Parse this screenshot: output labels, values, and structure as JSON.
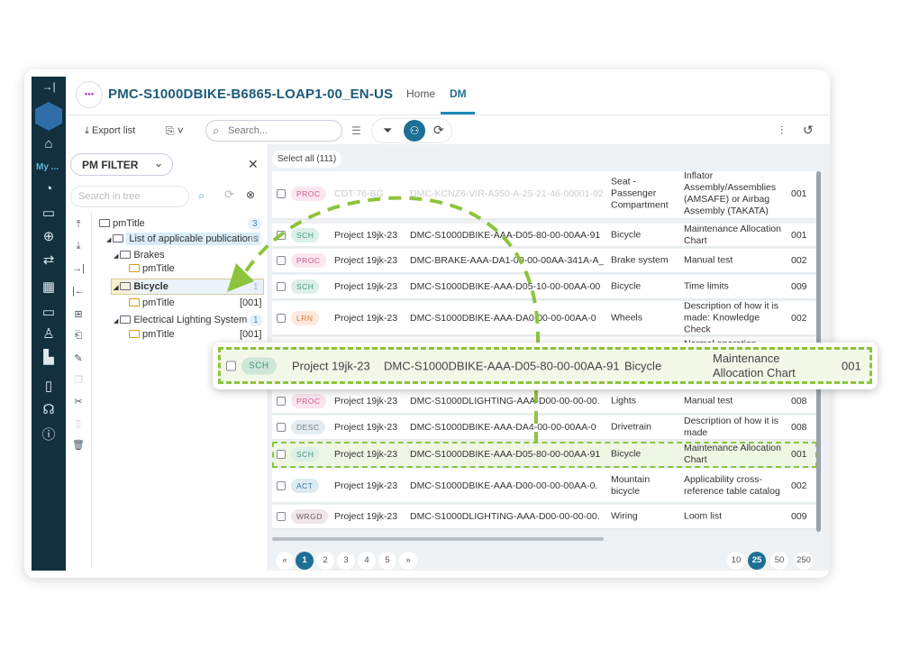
{
  "header": {
    "title": "PMC-S1000DBIKE-B6865-LOAP1-00_EN-US",
    "logo_text": "logo",
    "tabs": [
      {
        "label": "Home",
        "active": false
      },
      {
        "label": "DM",
        "active": true
      }
    ]
  },
  "sidebar": {
    "my_label": "My ...",
    "icons": [
      "collapse-icon",
      "home-icon",
      "pie-chart-icon",
      "folder-open-icon",
      "crosshair-icon",
      "transfer-icon",
      "building-icon",
      "folder-icon",
      "add-user-icon",
      "factory-icon",
      "document-icon",
      "support-icon",
      "info-icon"
    ]
  },
  "toolbar": {
    "export_label": "Export list",
    "search_placeholder": "Search..."
  },
  "filter": {
    "label": "PM FILTER",
    "tree_search_placeholder": "Search in tree"
  },
  "tree": [
    {
      "label": "pmTitle",
      "count": "3"
    },
    {
      "label": "List of applicable publications",
      "count": "3"
    },
    {
      "label": "Brakes",
      "count": ""
    },
    {
      "label": "pmTitle",
      "count": "[001]"
    },
    {
      "label": "Bicycle",
      "count": "1"
    },
    {
      "label": "pmTitle",
      "count": "[001]"
    },
    {
      "label": "Electrical Lighting System",
      "count": "1"
    },
    {
      "label": "pmTitle",
      "count": "[001]"
    }
  ],
  "table": {
    "select_all": "Select all (111)",
    "rows": [
      {
        "type": "PROC",
        "project": "CDT-76-BG",
        "dmc": "DMC-KCNZ6-VIR-A350-A-25-21-46-00001-921",
        "info": "Seat - Passenger Compartment",
        "title": "Inflator Assembly/Assemblies (AMSAFE) or Airbag Assembly (TAKATA)",
        "issue": "001"
      },
      {
        "type": "SCH",
        "project": "Project 19jk-23",
        "dmc": "DMC-S1000DBIKE-AAA-D05-80-00-00AA-91",
        "info": "Bicycle",
        "title": "Maintenance Allocation Chart",
        "issue": "001"
      },
      {
        "type": "PROC",
        "project": "Project 19jk-23",
        "dmc": "DMC-BRAKE-AAA-DA1-00-00-00AA-341A-A_",
        "info": "Brake system",
        "title": "Manual test",
        "issue": "002"
      },
      {
        "type": "SCH",
        "project": "Project 19jk-23",
        "dmc": "DMC-S1000DBIKE-AAA-D05-10-00-00AA-00",
        "info": "Bicycle",
        "title": "Time limits",
        "issue": "009"
      },
      {
        "type": "LRN",
        "project": "Project 19jk-23",
        "dmc": "DMC-S1000DBIKE-AAA-DA0-00-00-00AA-0",
        "info": "Wheels",
        "title": "Description of how it is made: Knowledge Check",
        "issue": "002"
      },
      {
        "type": "",
        "project": "",
        "dmc": "",
        "info": "",
        "title": "Normal operation",
        "issue": ""
      },
      {
        "type": "PROC",
        "project": "Project 19jk-23",
        "dmc": "DMC-S1000DLIGHTING-AAA-D00-00-00-00.",
        "info": "Lights",
        "title": "Manual test",
        "issue": "008"
      },
      {
        "type": "DESC",
        "project": "Project 19jk-23",
        "dmc": "DMC-S1000DBIKE-AAA-DA4-00-00-00AA-0",
        "info": "Drivetrain",
        "title": "Description of how it is made",
        "issue": "008"
      },
      {
        "type": "SCH",
        "project": "Project 19jk-23",
        "dmc": "DMC-S1000DBIKE-AAA-D05-80-00-00AA-91",
        "info": "Bicycle",
        "title": "Maintenance Allocation Chart",
        "issue": "001"
      },
      {
        "type": "ACT",
        "project": "Project 19jk-23",
        "dmc": "DMC-S1000DBIKE-AAA-D00-00-00-00AA-0.",
        "info": "Mountain bicycle",
        "title": "Applicability cross-reference table catalog",
        "issue": "002"
      },
      {
        "type": "WRGD",
        "project": "Project 19jk-23",
        "dmc": "DMC-S1000DLIGHTING-AAA-D00-00-00-00.",
        "info": "Wiring",
        "title": "Loom list",
        "issue": "009"
      }
    ],
    "dragged_row": {
      "type": "SCH",
      "project": "Project 19jk-23",
      "dmc": "DMC-S1000DBIKE-AAA-D05-80-00-00AA-91",
      "info": "Bicycle",
      "title": "Maintenance Allocation Chart",
      "issue": "001"
    }
  },
  "pagination": {
    "prev": "«",
    "pages": [
      "1",
      "2",
      "3",
      "4",
      "5"
    ],
    "next": "»",
    "current": "1",
    "page_sizes": [
      "10",
      "25",
      "50",
      "250"
    ],
    "current_size": "25"
  },
  "colors": {
    "accent": "#1d6f96",
    "sidebar": "#12303e",
    "highlight": "#8cc43c"
  },
  "badge_colors": {
    "PROC": [
      "#fbe6ef",
      "#d0568c"
    ],
    "SCH": [
      "#dcefe8",
      "#3f9a7c"
    ],
    "LRN": [
      "#fde8dc",
      "#e07a3c"
    ],
    "DESC": [
      "#e6ecf0",
      "#6a8090"
    ],
    "ACT": [
      "#dcebf2",
      "#3d7a99"
    ],
    "WRGD": [
      "#efe6ea",
      "#7a5566"
    ]
  }
}
